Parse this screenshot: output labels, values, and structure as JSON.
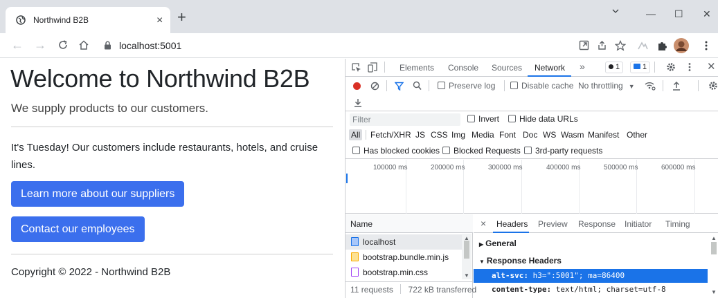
{
  "browser": {
    "tab_title": "Northwind B2B",
    "tab_close": "×",
    "new_tab": "+",
    "url": "localhost:5001",
    "window": {
      "minimize": "—",
      "maximize": "☐",
      "close": "✕",
      "chevron": "⌄"
    }
  },
  "page": {
    "heading": "Welcome to Northwind B2B",
    "lead": "We supply products to our customers.",
    "paragraph": "It's Tuesday! Our customers include restaurants, hotels, and cruise lines.",
    "button_suppliers": "Learn more about our suppliers",
    "button_employees": "Contact our employees",
    "footer": "Copyright © 2022 - Northwind B2B",
    "button_color": "#3b6fed"
  },
  "devtools": {
    "tabs": [
      "Elements",
      "Console",
      "Sources",
      "Network"
    ],
    "active_tab": "Network",
    "more": "»",
    "errors_count": "1",
    "messages_count": "1",
    "toolbar": {
      "preserve_log": "Preserve log",
      "disable_cache": "Disable cache",
      "throttling": "No throttling"
    },
    "filter": {
      "placeholder": "Filter",
      "invert": "Invert",
      "hide_data_urls": "Hide data URLs"
    },
    "types": [
      "All",
      "Fetch/XHR",
      "JS",
      "CSS",
      "Img",
      "Media",
      "Font",
      "Doc",
      "WS",
      "Wasm",
      "Manifest",
      "Other"
    ],
    "blocked": {
      "has_blocked_cookies": "Has blocked cookies",
      "blocked_requests": "Blocked Requests",
      "third_party": "3rd-party requests"
    },
    "timeline_ticks": [
      "100000 ms",
      "200000 ms",
      "300000 ms",
      "400000 ms",
      "500000 ms",
      "600000 ms"
    ],
    "name_header": "Name",
    "requests": [
      {
        "name": "localhost",
        "type": "doc"
      },
      {
        "name": "bootstrap.bundle.min.js",
        "type": "script"
      },
      {
        "name": "bootstrap.min.css",
        "type": "css"
      }
    ],
    "status": {
      "requests": "11 requests",
      "transferred": "722 kB transferred"
    },
    "detail_close": "×",
    "detail_tabs": [
      "Headers",
      "Preview",
      "Response",
      "Initiator",
      "Timing"
    ],
    "active_detail_tab": "Headers",
    "general_label": "General",
    "response_headers_label": "Response Headers",
    "alt_svc_name": "alt-svc:",
    "alt_svc_value": "h3=\":5001\"; ma=86400",
    "content_type_name": "content-type:",
    "content_type_value": "text/html; charset=utf-8",
    "accent": "#1a73e8"
  }
}
